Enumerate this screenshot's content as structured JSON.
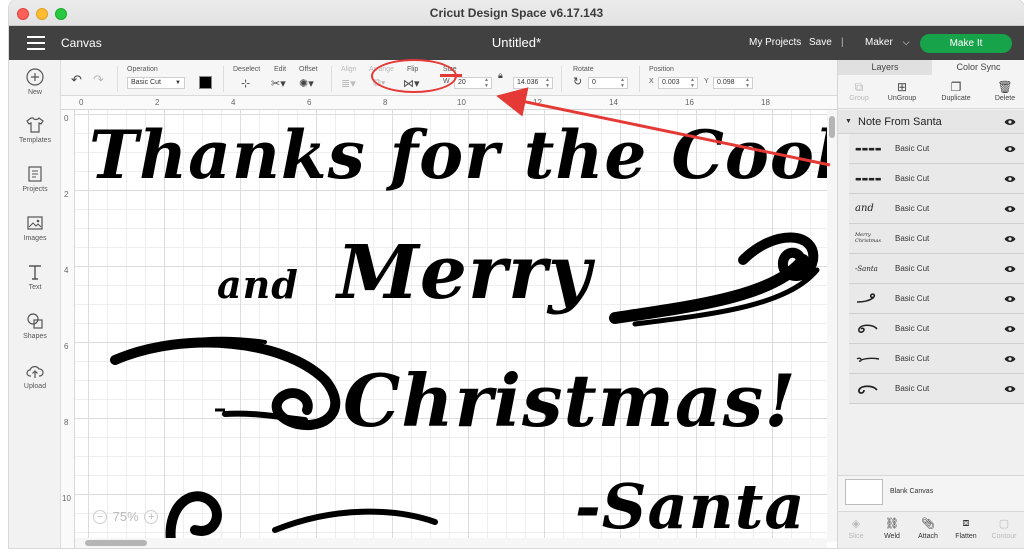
{
  "window": {
    "title": "Cricut Design Space  v6.17.143"
  },
  "header": {
    "section": "Canvas",
    "doc_title": "Untitled*",
    "my_projects": "My Projects",
    "save": "Save",
    "separator": "|",
    "machine": "Maker",
    "make_it": "Make It"
  },
  "leftbar": {
    "items": [
      {
        "label": "New"
      },
      {
        "label": "Templates"
      },
      {
        "label": "Projects"
      },
      {
        "label": "Images"
      },
      {
        "label": "Text"
      },
      {
        "label": "Shapes"
      },
      {
        "label": "Upload"
      }
    ]
  },
  "toolbar": {
    "operation_label": "Operation",
    "operation_value": "Basic Cut",
    "deselect_label": "Deselect",
    "edit_label": "Edit",
    "offset_label": "Offset",
    "align_label": "Align",
    "arrange_label": "Arrange",
    "flip_label": "Flip",
    "size_label": "Size",
    "w_letter": "W",
    "w_value": "20",
    "h_value": "14.036",
    "rotate_label": "Rotate",
    "rotate_value": "0",
    "position_label": "Position",
    "x_letter": "X",
    "x_value": "0.003",
    "y_letter": "Y",
    "y_value": "0.098"
  },
  "ruler": {
    "top": [
      "0",
      "2",
      "4",
      "6",
      "8",
      "10",
      "12",
      "14",
      "16",
      "18"
    ],
    "left": [
      "0",
      "2",
      "4",
      "6",
      "8",
      "10"
    ]
  },
  "canvas": {
    "line1": "Thanks for the Cookies",
    "line2": "and",
    "line3": "Merry",
    "line4": "Christmas!",
    "line5": "-Santa",
    "zoom": "75%",
    "zoom_minus": "−",
    "zoom_plus": "+"
  },
  "rightpanel": {
    "tab_layers": "Layers",
    "tab_sync": "Color Sync",
    "actions": [
      {
        "label": "Group",
        "icon": "group-icon"
      },
      {
        "label": "UnGroup",
        "icon": "ungroup-icon"
      },
      {
        "label": "Duplicate",
        "icon": "duplicate-icon"
      },
      {
        "label": "Delete",
        "icon": "trash-icon"
      }
    ],
    "group_name": "Note From Santa",
    "layers": [
      {
        "name": "Basic Cut"
      },
      {
        "name": "Basic Cut"
      },
      {
        "name": "Basic Cut",
        "thumb": "and"
      },
      {
        "name": "Basic Cut",
        "thumb": "Merry Christmas"
      },
      {
        "name": "Basic Cut",
        "thumb": "-Santa"
      },
      {
        "name": "Basic Cut"
      },
      {
        "name": "Basic Cut"
      },
      {
        "name": "Basic Cut"
      },
      {
        "name": "Basic Cut"
      }
    ],
    "blank_canvas": "Blank Canvas",
    "bottom_actions": [
      {
        "label": "Slice",
        "icon": "slice-icon"
      },
      {
        "label": "Weld",
        "icon": "weld-icon"
      },
      {
        "label": "Attach",
        "icon": "attach-icon"
      },
      {
        "label": "Flatten",
        "icon": "flatten-icon"
      },
      {
        "label": "Contour",
        "icon": "contour-icon"
      }
    ]
  },
  "colors": {
    "header_bg": "#414141",
    "make_it": "#17a34a",
    "annotation_red": "#e53935"
  }
}
